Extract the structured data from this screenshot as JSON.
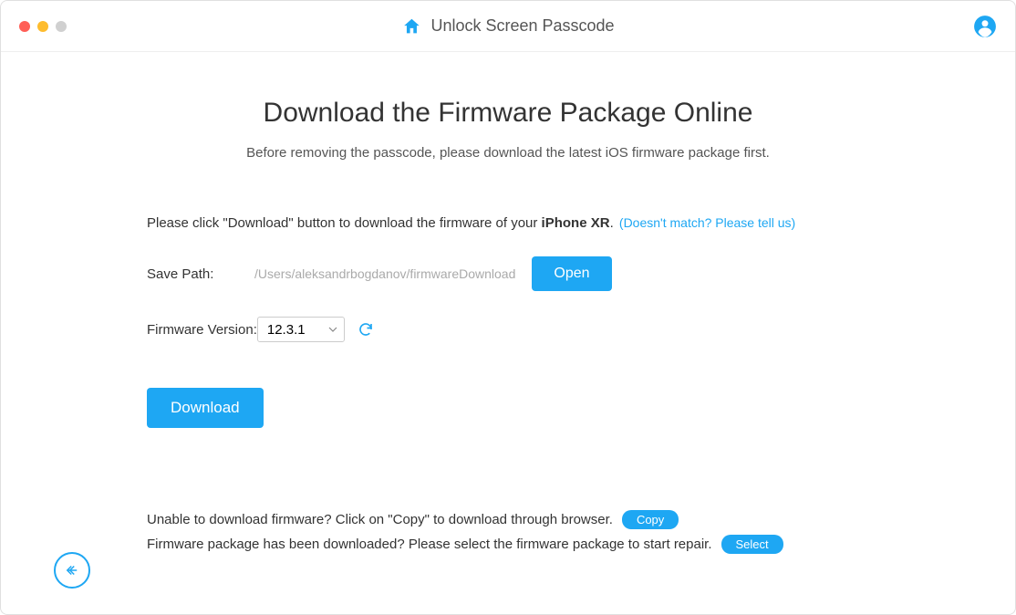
{
  "header": {
    "title": "Unlock Screen Passcode"
  },
  "main": {
    "heading": "Download the Firmware Package Online",
    "subheading": "Before removing the passcode, please download the latest iOS firmware package first.",
    "instruction_prefix": "Please click \"Download\" button to download the firmware of your ",
    "device_model": "iPhone XR",
    "instruction_suffix": ".",
    "mismatch_link": "(Doesn't match? Please tell us)",
    "save_path_label": "Save Path:",
    "save_path_value": "/Users/aleksandrbogdanov/firmwareDownload",
    "open_button": "Open",
    "firmware_label": "Firmware Version:",
    "firmware_version": "12.3.1",
    "download_button": "Download"
  },
  "bottom": {
    "line1": "Unable to download firmware? Click on \"Copy\" to download through browser.",
    "copy_button": "Copy",
    "line2": "Firmware package has been downloaded? Please select the firmware package to start repair.",
    "select_button": "Select"
  }
}
